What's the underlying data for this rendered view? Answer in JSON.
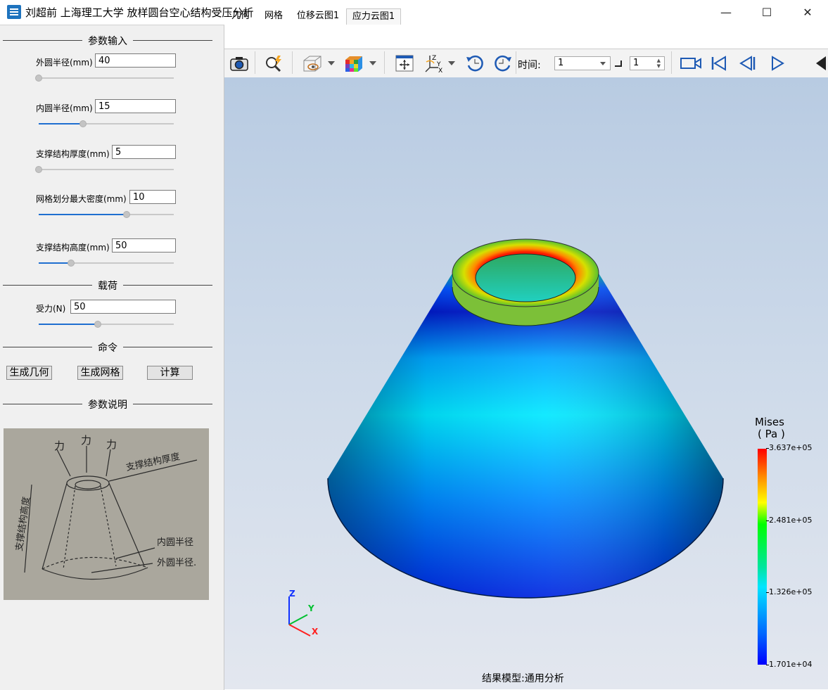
{
  "window": {
    "title": "刘超前 上海理工大学 放样圆台空心结构受压分析",
    "minimize": "—",
    "maximize": "☐",
    "close": "✕"
  },
  "sections": {
    "params": "参数输入",
    "load": "载荷",
    "commands": "命令",
    "explanation": "参数说明"
  },
  "params": [
    {
      "label": "外圆半径(mm)",
      "value": "40",
      "slider": 0.0
    },
    {
      "label": "内圆半径(mm)",
      "value": "15",
      "slider": 0.33
    },
    {
      "label": "支撑结构厚度(mm)",
      "value": "5",
      "slider": 0.0
    },
    {
      "label": "网格划分最大密度(mm)",
      "value": "10",
      "slider": 0.65
    },
    {
      "label": "支撑结构高度(mm)",
      "value": "50",
      "slider": 0.24
    }
  ],
  "load": {
    "label": "受力(N)",
    "value": "50",
    "slider": 0.44
  },
  "buttons": {
    "gen_geometry": "生成几何",
    "gen_mesh": "生成网格",
    "compute": "计算"
  },
  "sketch": {
    "force1": "力",
    "force2": "力",
    "force3": "力",
    "thickness": "支撑结构厚度",
    "height": "支撑结构高度",
    "inner_radius": "内圆半径",
    "outer_radius": "外圆半径."
  },
  "tabs": [
    {
      "label": "几何",
      "active": false
    },
    {
      "label": "网格",
      "active": false
    },
    {
      "label": "位移云图1",
      "active": false
    },
    {
      "label": "应力云图1",
      "active": true
    }
  ],
  "toolbar": {
    "time_label": "时间:",
    "time_value": "1",
    "step_value": "1",
    "icons": [
      "camera-icon",
      "zoom-icon",
      "view-icon",
      "color-cube-icon",
      "fit-icon",
      "axes-icon",
      "rotate-ccw-icon",
      "rotate-cw-icon",
      "record-icon",
      "first-frame-icon",
      "prev-frame-icon",
      "play-icon",
      "more-icon"
    ]
  },
  "viewport": {
    "footer": "结果模型:通用分析",
    "triad": {
      "z": "Z",
      "y": "Y",
      "x": "X"
    }
  },
  "legend": {
    "title": "Mises",
    "unit": "( Pa )",
    "max": "3.637e+05",
    "v2": "2.481e+05",
    "v3": "1.326e+05",
    "min": "1.701e+04",
    "colors": [
      "#ff0000",
      "#ffff00",
      "#00ff00",
      "#00e5ff",
      "#0000ff"
    ]
  }
}
